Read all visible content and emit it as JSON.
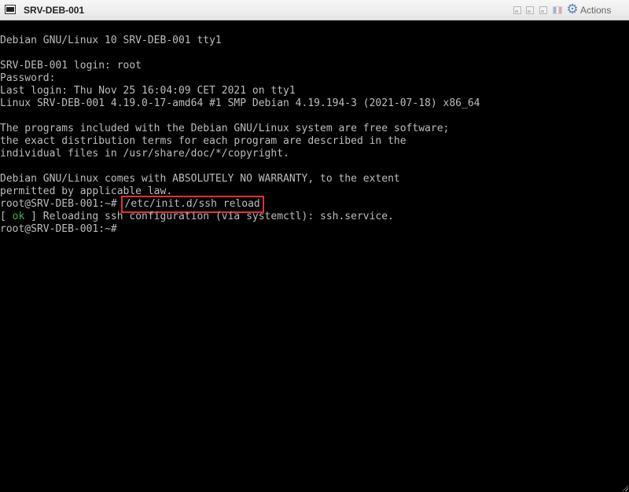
{
  "window": {
    "title": "SRV-DEB-001",
    "actions_label": "Actions",
    "icons": [
      "console-icon",
      "window-btn-icon",
      "flag-icon",
      "gear-icon"
    ]
  },
  "terminal": {
    "lines": {
      "banner": "Debian GNU/Linux 10 SRV-DEB-001 tty1",
      "login": "SRV-DEB-001 login: root",
      "password": "Password:",
      "last_login": "Last login: Thu Nov 25 16:04:09 CET 2021 on tty1",
      "uname": "Linux SRV-DEB-001 4.19.0-17-amd64 #1 SMP Debian 4.19.194-3 (2021-07-18) x86_64",
      "motd1": "The programs included with the Debian GNU/Linux system are free software;",
      "motd2": "the exact distribution terms for each program are described in the",
      "motd3": "individual files in /usr/share/doc/*/copyright.",
      "warranty1": "Debian GNU/Linux comes with ABSOLUTELY NO WARRANTY, to the extent",
      "warranty2": "permitted by applicable law.",
      "prompt1": "root@SRV-DEB-001:~# ",
      "command": "/etc/init.d/ssh reload",
      "status_open": "[ ",
      "status_ok": "ok",
      "status_rest": " ] Reloading ssh configuration (via systemctl): ssh.service.",
      "prompt2": "root@SRV-DEB-001:~#"
    },
    "colors": {
      "text": "#bdbdbd",
      "ok": "#3fb83f",
      "highlight_box": "#e53030"
    }
  }
}
